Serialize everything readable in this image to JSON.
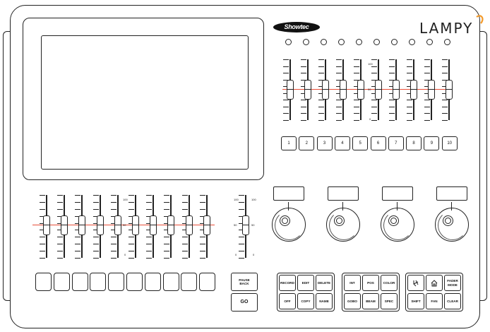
{
  "brand": {
    "logo": "Showtec",
    "product": "LAMPY"
  },
  "top_faders": {
    "count": 10,
    "scale_top": "100",
    "scale_mid": "50",
    "scale_bottom": "0"
  },
  "number_buttons": [
    "1",
    "2",
    "3",
    "4",
    "5",
    "6",
    "7",
    "8",
    "9",
    "10"
  ],
  "bottom_faders": {
    "count": 10,
    "scale_top": "100",
    "scale_mid": "50",
    "scale_bottom": "0"
  },
  "master_fader": {
    "scale_top": "100",
    "scale_mid": "50",
    "scale_bottom": "0"
  },
  "encoders": {
    "count": 4
  },
  "flash_buttons": {
    "count": 10
  },
  "playback": {
    "pause_back": "PAUSE\nBACK",
    "go": "GO"
  },
  "programming": {
    "record": "RECORD",
    "edit": "EDIT",
    "delete": "DELETE",
    "off": "OFF",
    "copy": "COPY",
    "name": "NAME"
  },
  "attributes": {
    "int": "INT",
    "pos": "POS",
    "color": "COLOR",
    "gobo": "GOBO",
    "beam": "BEAM",
    "spec": "SPEC"
  },
  "functions": {
    "fixture_icon": "fixture-icon",
    "home_icon": "home-icon",
    "fader_mode": "FADER\nMODE",
    "shift": "SHIFT",
    "fan": "FAN",
    "clear": "CLEAR"
  },
  "colors": {
    "outline": "#222222",
    "accent_red": "#e8503a",
    "logo_orange": "#f39a2b"
  }
}
